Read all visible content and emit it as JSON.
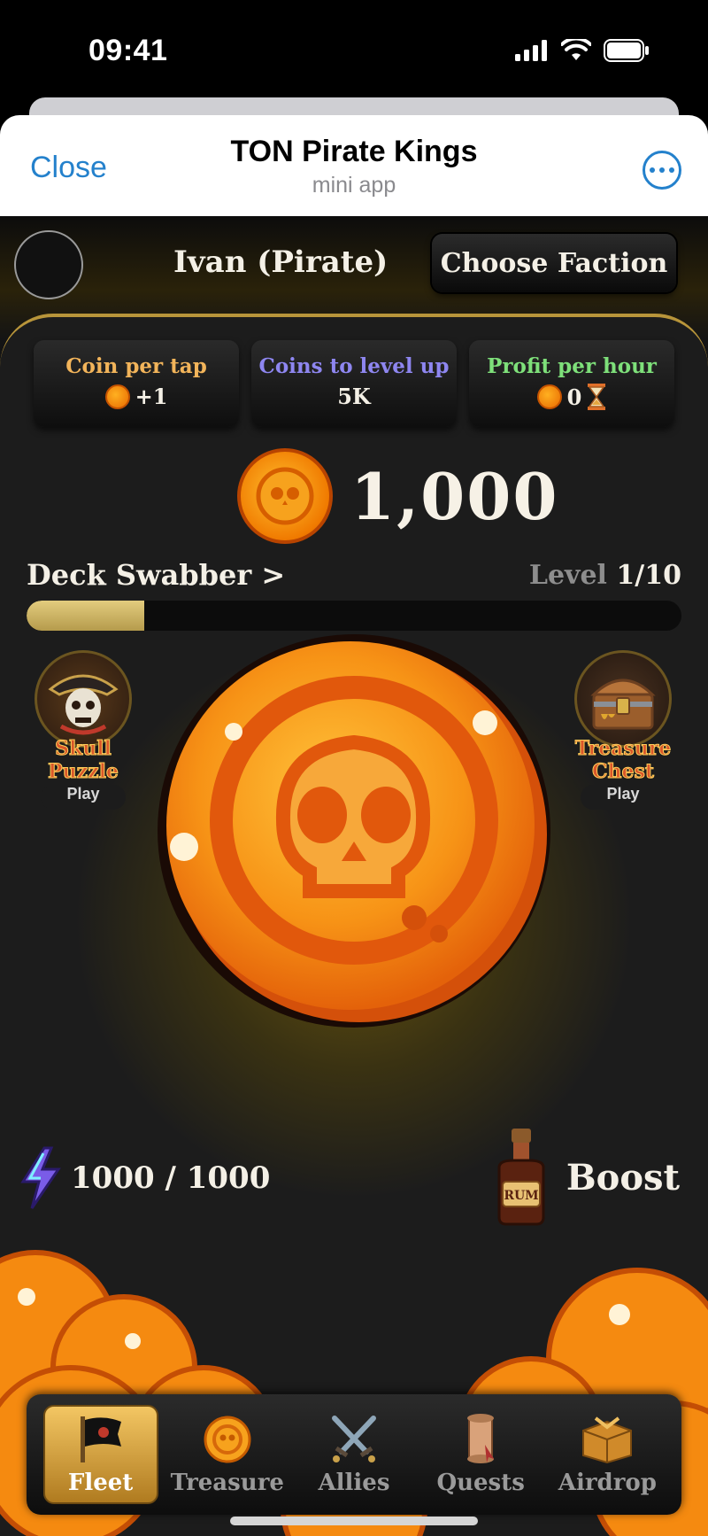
{
  "status_bar": {
    "time": "09:41"
  },
  "telegram": {
    "close_label": "Close",
    "title": "TON Pirate Kings",
    "subtitle": "mini app"
  },
  "player": {
    "name": "Ivan (Pirate)",
    "choose_faction_label": "Choose Faction"
  },
  "stats": [
    {
      "label": "Coin per tap",
      "value": "+1",
      "color": "#f2b45a"
    },
    {
      "label": "Coins to level up",
      "value": "5K",
      "color": "#8e86f0"
    },
    {
      "label": "Profit per hour",
      "value": "0",
      "color": "#7ee07a"
    }
  ],
  "balance": "1,000",
  "rank": {
    "name": "Deck Swabber >",
    "level_label": "Level",
    "level_value": "1/10",
    "progress": 0.18
  },
  "side_games": {
    "left": {
      "name": "Skull Puzzle",
      "action": "Play"
    },
    "right": {
      "name": "Treasure Chest",
      "action": "Play"
    }
  },
  "energy": "1000 / 1000",
  "boost_label": "Boost",
  "rum_label": "RUM",
  "nav": [
    {
      "label": "Fleet",
      "icon": "flag-icon",
      "active": true
    },
    {
      "label": "Treasure",
      "icon": "coin-icon",
      "active": false
    },
    {
      "label": "Allies",
      "icon": "crossed-swords-icon",
      "active": false
    },
    {
      "label": "Quests",
      "icon": "scroll-icon",
      "active": false
    },
    {
      "label": "Airdrop",
      "icon": "box-icon",
      "active": false
    }
  ]
}
